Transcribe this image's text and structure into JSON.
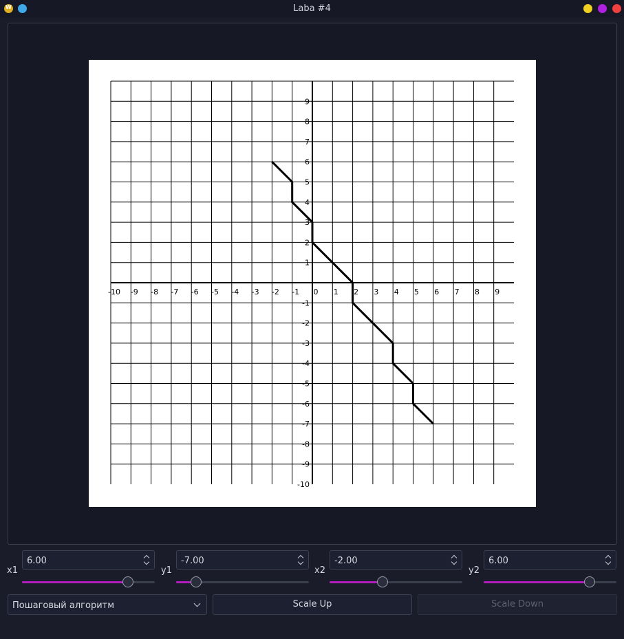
{
  "window": {
    "title": "Laba #4",
    "buttons": [
      "app-icon",
      "pin",
      "minimize",
      "maximize",
      "close"
    ]
  },
  "controls": {
    "x1": {
      "label": "x1",
      "value": "6.00",
      "slider": 0.8
    },
    "y1": {
      "label": "y1",
      "value": "-7.00",
      "slider": 0.15
    },
    "x2": {
      "label": "x2",
      "value": "-2.00",
      "slider": 0.4
    },
    "y2": {
      "label": "y2",
      "value": "6.00",
      "slider": 0.8
    },
    "algorithm": {
      "selected": "Пошаговый алгоритм"
    },
    "scale_up_label": "Scale Up",
    "scale_down_label": "Scale Down"
  },
  "colors": {
    "accent": "#b01ec0",
    "background": "#1a1d29",
    "canvas": "#ffffff"
  },
  "chart_data": {
    "type": "line",
    "xlim": [
      -10,
      10
    ],
    "ylim": [
      -10,
      10
    ],
    "grid": true,
    "x_tick_labels": [
      "-10",
      "-9",
      "-8",
      "-7",
      "-6",
      "-5",
      "-4",
      "-3",
      "-2",
      "-1",
      "0",
      "1",
      "2",
      "3",
      "4",
      "5",
      "6",
      "7",
      "8",
      "9"
    ],
    "y_tick_labels": [
      "9",
      "8",
      "7",
      "6",
      "5",
      "4",
      "3",
      "2",
      "1",
      "-1",
      "-2",
      "-3",
      "-4",
      "-5",
      "-6",
      "-7",
      "-8",
      "-9",
      "-10"
    ],
    "series": [
      {
        "x": [
          -2,
          -1,
          -1,
          0,
          0,
          2,
          2,
          4,
          4,
          5,
          5,
          6
        ],
        "y": [
          6,
          5,
          4,
          3,
          2,
          0,
          -1,
          -3,
          -4,
          -5,
          -6,
          -7
        ]
      }
    ]
  }
}
